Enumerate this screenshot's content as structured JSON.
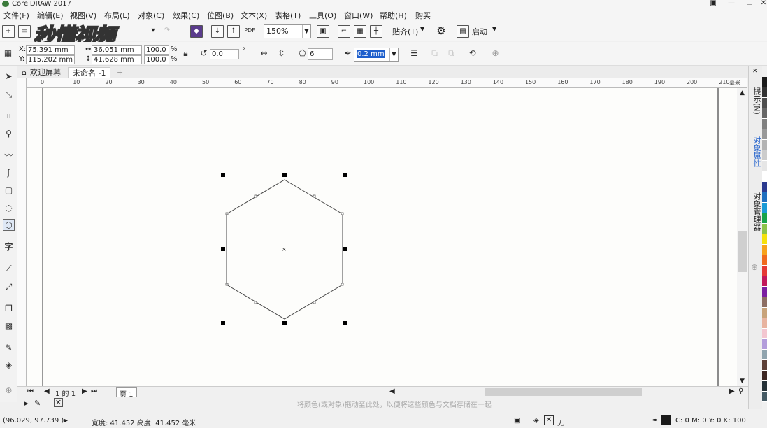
{
  "app": {
    "title": "CorelDRAW 2017"
  },
  "menu": [
    "文件(F)",
    "编辑(E)",
    "视图(V)",
    "布局(L)",
    "对象(C)",
    "效果(C)",
    "位图(B)",
    "文本(X)",
    "表格(T)",
    "工具(O)",
    "窗口(W)",
    "帮助(H)",
    "购买"
  ],
  "toolbar": {
    "zoom": "150%",
    "snap_label": "贴齐(T)",
    "launch_label": "启动",
    "pdf_label": "PDF"
  },
  "watermark": "秒懂视频",
  "propbar": {
    "x_label": "X:",
    "x": "75.391 mm",
    "y_label": "Y:",
    "y": "115.202 mm",
    "w": "36.051 mm",
    "h": "41.628 mm",
    "scale_x": "100.0",
    "scale_y": "100.0",
    "percent": "%",
    "rotation": "0.0",
    "degree": "°",
    "sides": "6",
    "outline": "0.2 mm"
  },
  "tabs": {
    "welcome": "欢迎屏幕",
    "document": "未命名 -1",
    "add": "+"
  },
  "ruler": {
    "h_ticks": [
      "0",
      "10",
      "20",
      "30",
      "40",
      "50",
      "60",
      "70",
      "80",
      "90",
      "100",
      "110",
      "120",
      "130",
      "140",
      "150",
      "160",
      "170",
      "180",
      "190",
      "200",
      "210"
    ],
    "unit": "毫米"
  },
  "pagebar": {
    "page_info": "1 的 1",
    "page_tab": "页 1"
  },
  "color_hint": "将颜色(或对象)拖动至此处，以便将这些颜色与文档存储在一起",
  "dockers": {
    "hints": "提示(N)",
    "properties": "对象属性",
    "manager": "对象管理器"
  },
  "status": {
    "coords": "(96.029, 97.739 )",
    "size": "宽度: 41.452  高度: 41.452  毫米",
    "fill": "无",
    "outline_color": "C: 0 M: 0 Y: 0 K: 100"
  },
  "palette": [
    "#1a1a1a",
    "#333333",
    "#4d4d4d",
    "#666666",
    "#808080",
    "#999999",
    "#b3b3b3",
    "#cccccc",
    "#e6e6e6",
    "#ffffff",
    "#2b3a8f",
    "#1f6fbf",
    "#1a9ad6",
    "#17a34a",
    "#8bc34a",
    "#f5e10c",
    "#f7a21b",
    "#f06a1e",
    "#e53935",
    "#c2185b",
    "#7b1fa2",
    "#8d6e63",
    "#c8a37a",
    "#e8b4a0",
    "#f3c6d0",
    "#b39ddb",
    "#90a4ae",
    "#5d4037",
    "#3e2723",
    "#263238",
    "#455a64"
  ]
}
